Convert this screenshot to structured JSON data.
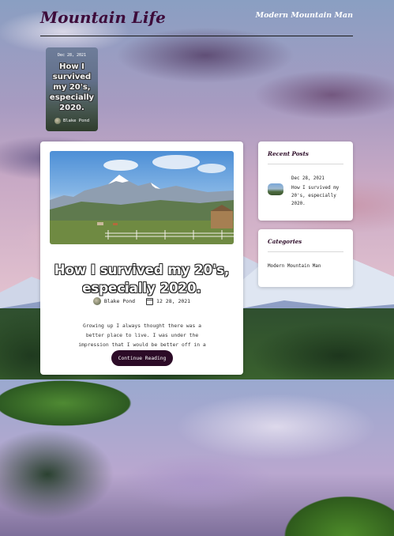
{
  "header": {
    "site_title": "Mountain Life",
    "tagline": "Modern Mountain Man"
  },
  "featured": {
    "date": "Dec 28, 2021",
    "title": "How I survived my 20's, especially 2020.",
    "author": "Blake Pond"
  },
  "post": {
    "title": "How I survived my 20's, especially 2020.",
    "author": "Blake Pond",
    "date": "12 28, 2021",
    "excerpt": "Growing up I always thought there was a better place to live. I was under the impression that I would be better off in a big city...",
    "button_label": "Continue Reading"
  },
  "sidebar": {
    "recent_posts": {
      "heading": "Recent Posts",
      "items": [
        {
          "date": "Dec 28, 2021",
          "title": "How I survived my 20's, especially 2020."
        }
      ]
    },
    "categories": {
      "heading": "Categories",
      "items": [
        "Modern Mountain Man"
      ]
    }
  },
  "icons": {
    "calendar": "calendar-icon",
    "avatar": "author-avatar"
  },
  "colors": {
    "accent": "#2c0b27",
    "title": "#3d0b3a",
    "card_bg": "#ffffff"
  }
}
